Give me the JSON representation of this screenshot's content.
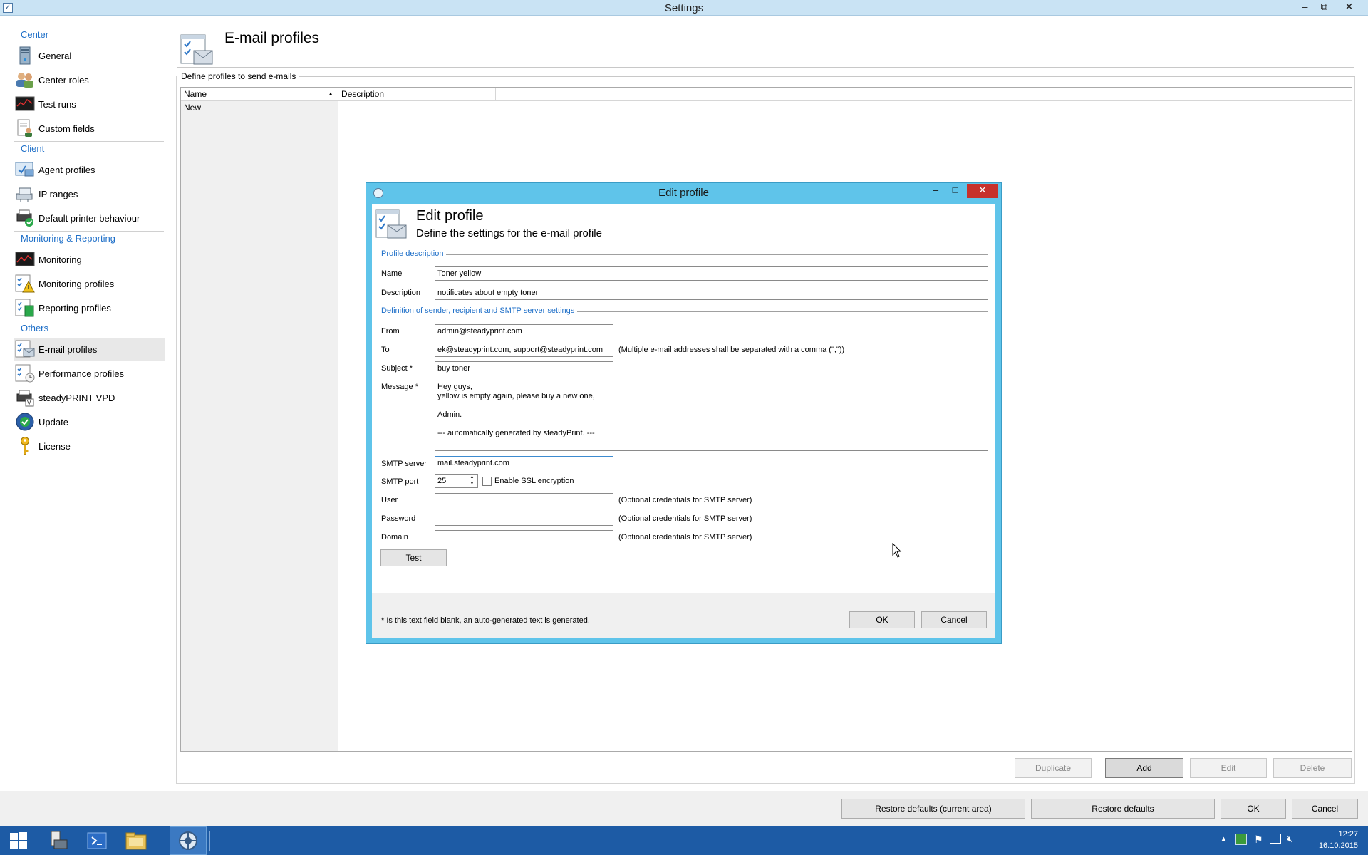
{
  "window": {
    "title": "Settings"
  },
  "nav": {
    "groups": [
      "Center",
      "Client",
      "Monitoring & Reporting",
      "Others"
    ],
    "items": [
      {
        "label": "General",
        "icon": "server-icon"
      },
      {
        "label": "Center roles",
        "icon": "users-icon"
      },
      {
        "label": "Test runs",
        "icon": "chart-monitor-icon"
      },
      {
        "label": "Custom fields",
        "icon": "document-user-icon"
      },
      {
        "label": "Agent profiles",
        "icon": "agent-profile-icon"
      },
      {
        "label": "IP ranges",
        "icon": "network-icon"
      },
      {
        "label": "Default printer behaviour",
        "icon": "printer-check-icon"
      },
      {
        "label": "Monitoring",
        "icon": "monitor-graph-icon"
      },
      {
        "label": "Monitoring profiles",
        "icon": "checklist-warning-icon"
      },
      {
        "label": "Reporting profiles",
        "icon": "checklist-report-icon"
      },
      {
        "label": "E-mail profiles",
        "icon": "checklist-mail-icon"
      },
      {
        "label": "Performance profiles",
        "icon": "checklist-clock-icon"
      },
      {
        "label": "steadyPRINT VPD",
        "icon": "printer-vpd-icon"
      },
      {
        "label": "Update",
        "icon": "update-check-icon"
      },
      {
        "label": "License",
        "icon": "key-icon"
      }
    ],
    "selected": "E-mail profiles"
  },
  "main": {
    "title": "E-mail profiles",
    "group_label": "Define profiles to send e-mails",
    "columns": [
      "Name",
      "Description"
    ],
    "rows": [
      "New"
    ],
    "buttons": {
      "duplicate": "Duplicate",
      "add": "Add",
      "edit": "Edit",
      "delete": "Delete"
    }
  },
  "footer": {
    "restore_current": "Restore defaults (current area)",
    "restore": "Restore defaults",
    "ok": "OK",
    "cancel": "Cancel"
  },
  "dialog": {
    "window_title": "Edit profile",
    "heading": "Edit profile",
    "subheading": "Define the settings for the e-mail profile",
    "section_profile": "Profile description",
    "section_smtp": "Definition of sender, recipient and SMTP server settings",
    "labels": {
      "name": "Name",
      "description": "Description",
      "from": "From",
      "to": "To",
      "subject": "Subject *",
      "message": "Message *",
      "smtp_server": "SMTP server",
      "smtp_port": "SMTP port",
      "user": "User",
      "password": "Password",
      "domain": "Domain"
    },
    "values": {
      "name": "Toner yellow",
      "description": "notificates about empty toner",
      "from": "admin@steadyprint.com",
      "to": "ek@steadyprint.com, support@steadyprint.com",
      "subject": "buy toner",
      "message": "Hey guys,\nyellow is empty again, please buy a new one,\n\nAdmin.\n\n--- automatically generated by steadyPrint. ---",
      "smtp_server": "mail.steadyprint.com",
      "smtp_port": "25",
      "user": "",
      "password": "",
      "domain": ""
    },
    "ssl_label": "Enable SSL encryption",
    "ssl_checked": false,
    "hints": {
      "to": "(Multiple e-mail addresses shall be separated with a comma (\",\"))",
      "user": "(Optional credentials for SMTP server)",
      "password": "(Optional credentials for SMTP server)",
      "domain": "(Optional credentials for SMTP server)"
    },
    "test_button": "Test",
    "footnote": "* Is this text field blank, an auto-generated text is generated.",
    "ok": "OK",
    "cancel": "Cancel"
  },
  "taskbar": {
    "time": "12:27",
    "date": "16.10.2015"
  },
  "colors": {
    "accent": "#1e6fc8",
    "dialog_frame": "#5fc4ea",
    "taskbar": "#1d5ba5",
    "close_button": "#c7312c"
  }
}
